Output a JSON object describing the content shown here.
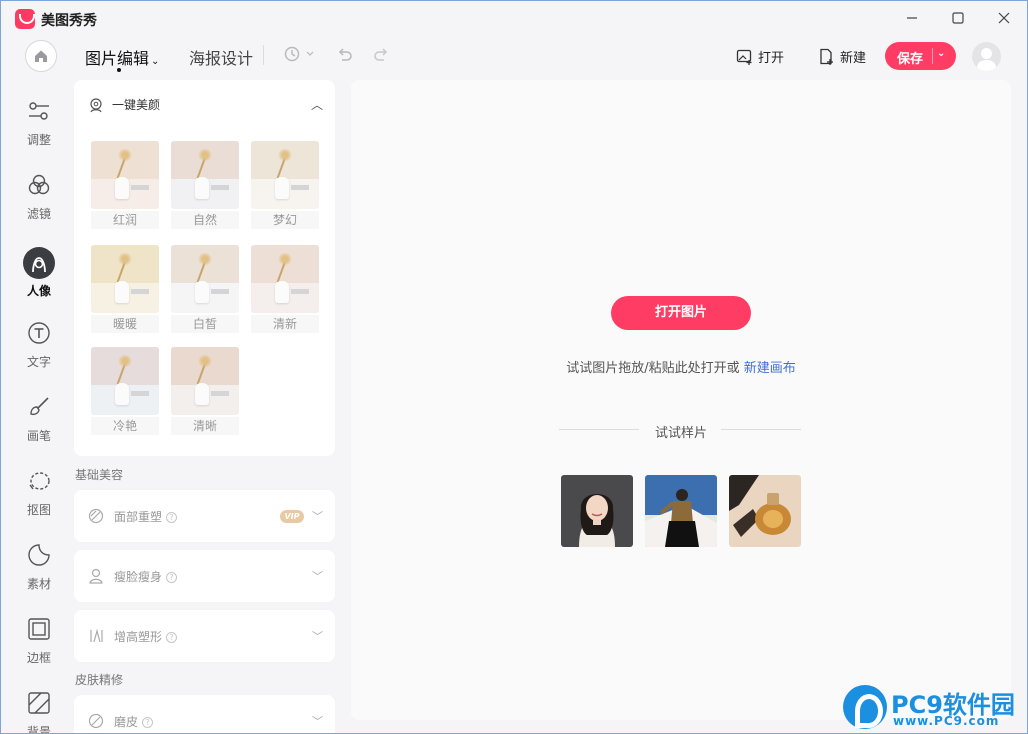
{
  "app": {
    "title": "美图秀秀",
    "window_controls": [
      "minimize-icon",
      "maximize-icon",
      "close-icon"
    ]
  },
  "toolbar": {
    "tabs": [
      {
        "label": "图片编辑",
        "active": true,
        "has_dropdown": true
      },
      {
        "label": "海报设计",
        "active": false
      }
    ],
    "history_icons": [
      "history-icon",
      "undo-icon",
      "redo-icon"
    ],
    "open_label": "打开",
    "new_label": "新建",
    "save_label": "保存"
  },
  "sidebar": {
    "items": [
      {
        "label": "调整",
        "icon": "sliders-icon",
        "active": false
      },
      {
        "label": "滤镜",
        "icon": "filter-icon",
        "active": false
      },
      {
        "label": "人像",
        "icon": "portrait-icon",
        "active": true
      },
      {
        "label": "文字",
        "icon": "text-icon",
        "active": false
      },
      {
        "label": "画笔",
        "icon": "brush-icon",
        "active": false
      },
      {
        "label": "抠图",
        "icon": "cutout-icon",
        "active": false
      },
      {
        "label": "素材",
        "icon": "sticker-icon",
        "active": false
      },
      {
        "label": "边框",
        "icon": "frame-icon",
        "active": false
      },
      {
        "label": "背景",
        "icon": "background-icon",
        "active": false
      }
    ]
  },
  "panel": {
    "one_click": {
      "title": "一键美颜",
      "presets": [
        "红润",
        "自然",
        "梦幻",
        "暖暖",
        "白皙",
        "清新",
        "冷艳",
        "清晰"
      ]
    },
    "basic_section_label": "基础美容",
    "basic_items": [
      {
        "label": "面部重塑",
        "vip": "VIP"
      },
      {
        "label": "瘦脸瘦身"
      },
      {
        "label": "增高塑形"
      }
    ],
    "skin_section_label": "皮肤精修",
    "skin_items": [
      {
        "label": "磨皮"
      }
    ]
  },
  "canvas": {
    "open_button": "打开图片",
    "hint_text": "试试图片拖放/粘贴此处打开或",
    "hint_link": "新建画布",
    "try_samples_label": "试试样片"
  },
  "watermark": {
    "text": "PC9软件园",
    "url": "www.PC9.com"
  },
  "colors": {
    "accent": "#ff3d64",
    "link": "#3d6fd6"
  }
}
